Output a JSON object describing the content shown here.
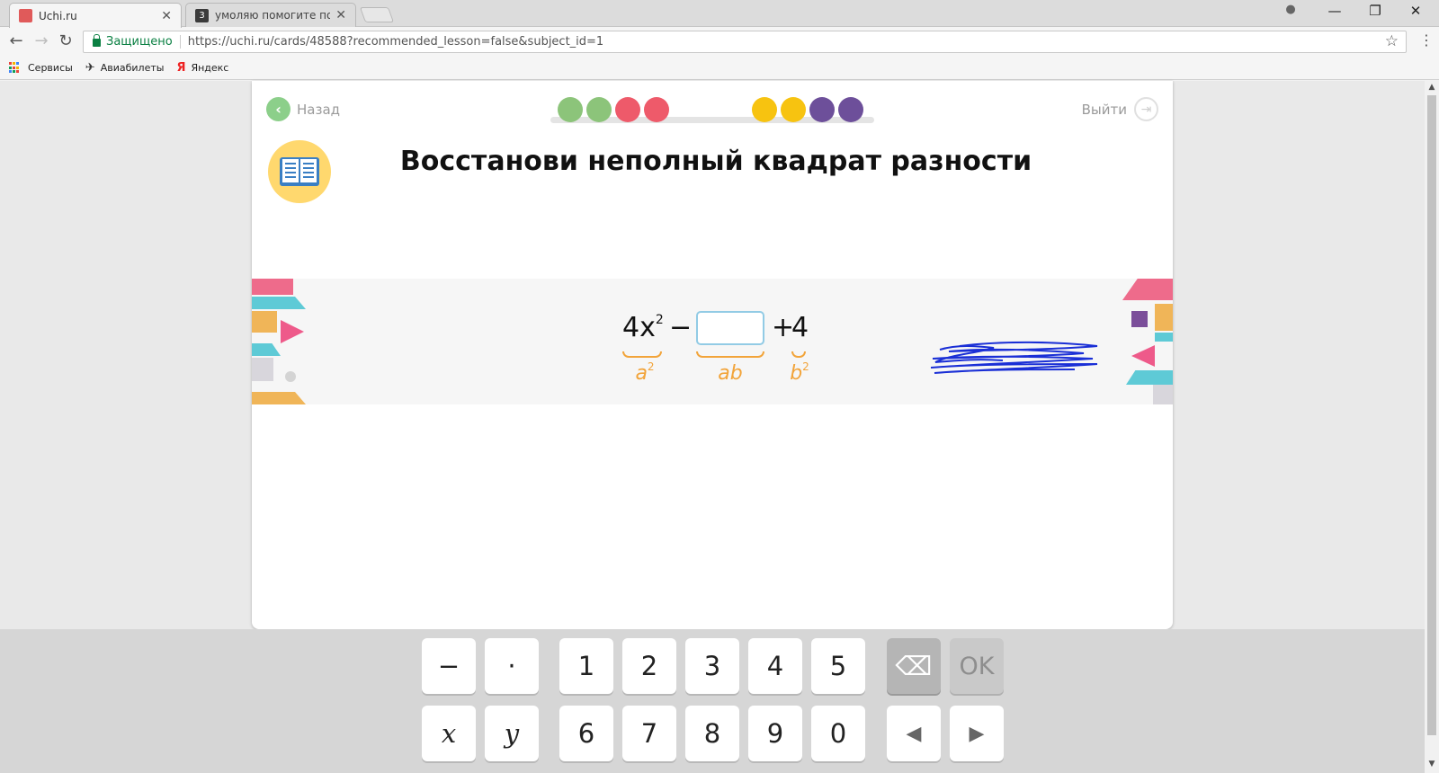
{
  "browser": {
    "tabs": [
      {
        "title": "Uchi.ru",
        "favicon_color": "#e05a5a",
        "active": true
      },
      {
        "title": "умоляю помогите пожа",
        "favicon_color": "#3b3b3b",
        "favicon_text": "3",
        "active": false
      }
    ],
    "tab_close": "✕",
    "window_controls": {
      "account": "●",
      "minimize": "—",
      "restore": "❐",
      "close": "✕"
    },
    "nav": {
      "back": "←",
      "forward": "→",
      "reload": "↻"
    },
    "omnibox": {
      "secure_label": "Защищено",
      "url": "https://uchi.ru/cards/48588?recommended_lesson=false&subject_id=1",
      "star": "☆"
    },
    "menu": "⋮",
    "bookmarks": [
      {
        "label": "Сервисы",
        "icon": "apps-grid-icon"
      },
      {
        "label": "Авиабилеты",
        "icon": "plane-icon",
        "glyph": "✈"
      },
      {
        "label": "Яндекс",
        "icon": "yandex-icon",
        "glyph": "Я"
      }
    ]
  },
  "card": {
    "back_label": "Назад",
    "back_glyph": "‹",
    "exit_label": "Выйти",
    "exit_glyph": "⇥",
    "title": "Восстанови неполный квадрат разности",
    "progress": [
      {
        "color": "#8cc47a"
      },
      {
        "color": "#8cc47a"
      },
      {
        "color": "#ee5a6a"
      },
      {
        "color": "#ee5a6a"
      },
      {
        "color": "#f7c310"
      },
      {
        "color": "#f7c310"
      },
      {
        "color": "#6d4f9a"
      },
      {
        "color": "#6d4f9a"
      }
    ]
  },
  "expression": {
    "first": "4x",
    "first_exp": "2",
    "minus": "−",
    "answer_value": "",
    "plus": "+",
    "last": "4",
    "labels": {
      "a": "a",
      "a_exp": "2",
      "ab": "ab",
      "b": "b",
      "b_exp": "2"
    }
  },
  "keyboard": {
    "row1": [
      "−",
      "·",
      "1",
      "2",
      "3",
      "4",
      "5"
    ],
    "row2": [
      "x",
      "y",
      "6",
      "7",
      "8",
      "9",
      "0"
    ],
    "backspace": "⌫",
    "ok": "OK",
    "left": "◀",
    "right": "▶"
  },
  "colors": {
    "accent_orange": "#f2a43a",
    "box_border": "#92cbe5",
    "scribble": "#1a2fd6"
  }
}
